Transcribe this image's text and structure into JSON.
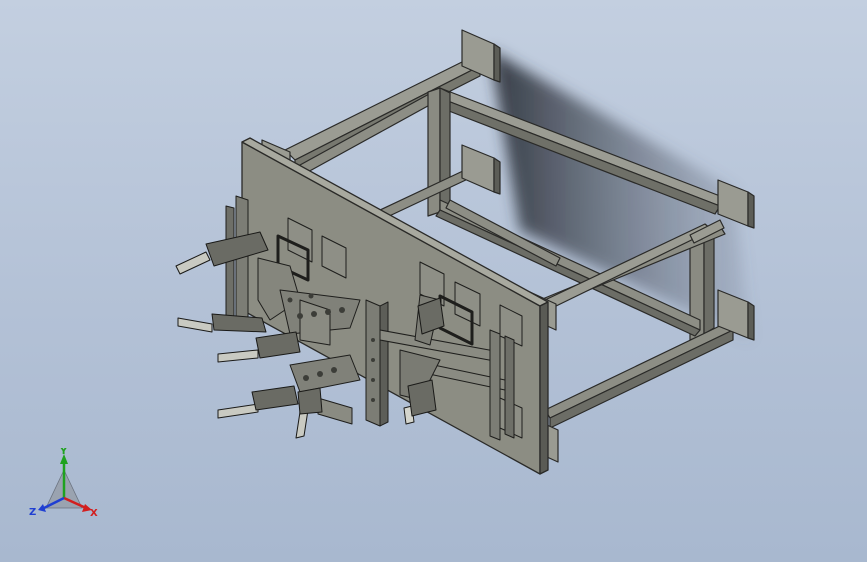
{
  "viewport": {
    "background_top": "#c3cfe0",
    "background_bottom": "#a8b8cf"
  },
  "model": {
    "frame_color": "#8a8a80",
    "frame_edge_color": "#2a2a28",
    "plate_color": "#8c8d83",
    "shadow_color": "#3a3f48",
    "fixture_color": "#7c7d75"
  },
  "triad": {
    "x_label": "X",
    "y_label": "Y",
    "z_label": "Z",
    "x_color": "#d21f1f",
    "y_color": "#1fa21f",
    "z_color": "#1f3fd2"
  }
}
